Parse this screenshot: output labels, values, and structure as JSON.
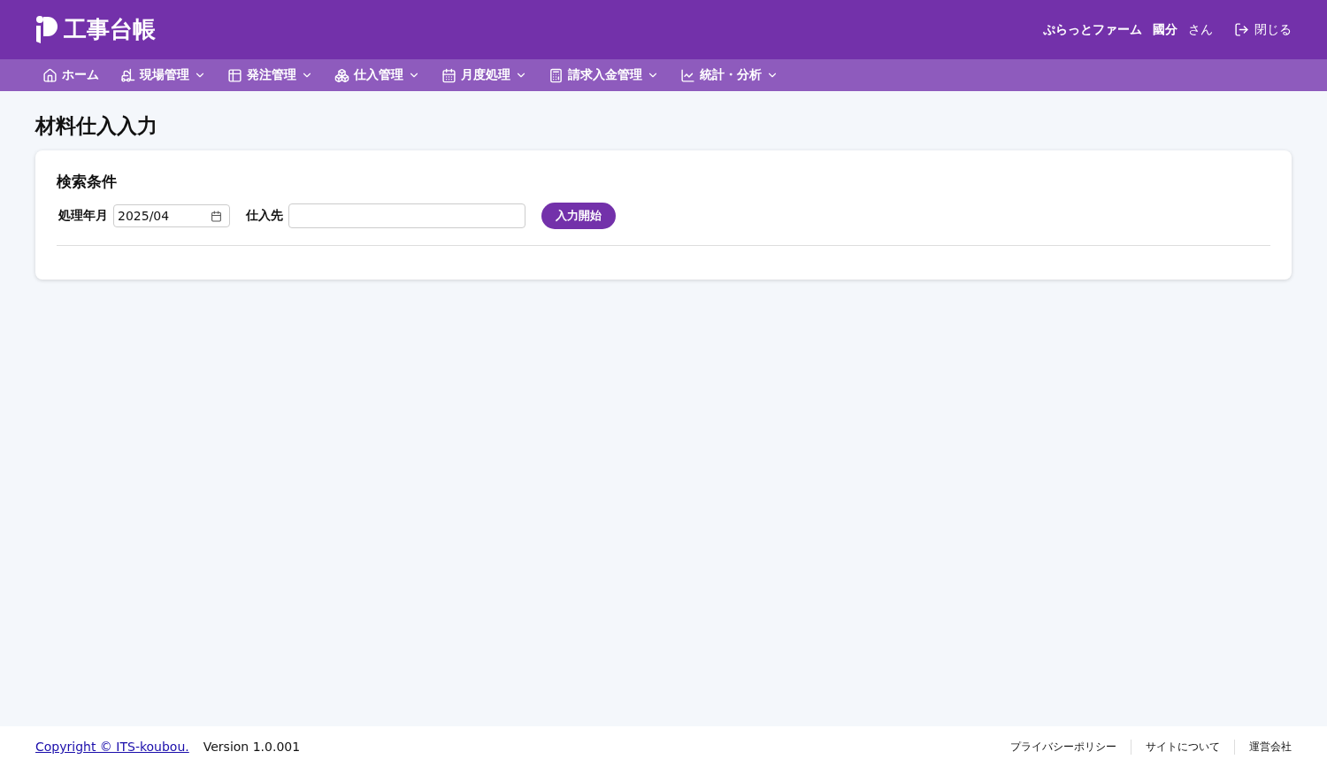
{
  "header": {
    "app_title": "工事台帳",
    "company": "ぷらっとファーム",
    "user_name": "國分",
    "honorific": "さん",
    "close_label": "閉じる"
  },
  "nav": [
    {
      "label": "ホーム",
      "kind": "link"
    },
    {
      "label": "現場管理",
      "kind": "menu"
    },
    {
      "label": "発注管理",
      "kind": "menu"
    },
    {
      "label": "仕入管理",
      "kind": "menu"
    },
    {
      "label": "月度処理",
      "kind": "menu"
    },
    {
      "label": "請求入金管理",
      "kind": "menu"
    },
    {
      "label": "統計・分析",
      "kind": "menu"
    }
  ],
  "page_title": "材料仕入入力",
  "search": {
    "title": "検索条件",
    "month_label": "処理年月",
    "month_value": "2025/04",
    "supplier_label": "仕入先",
    "button": "入力開始"
  },
  "footer": {
    "copyright": "Copyright © ITS-koubou.",
    "version": "Version 1.0.001",
    "links": [
      "プライバシーポリシー",
      "サイトについて",
      "運営会社"
    ]
  }
}
